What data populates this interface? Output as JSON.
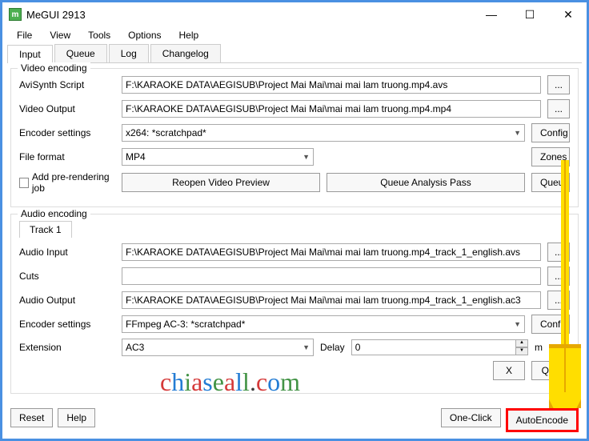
{
  "window": {
    "title": "MeGUI 2913"
  },
  "menubar": {
    "file": "File",
    "view": "View",
    "tools": "Tools",
    "options": "Options",
    "help": "Help"
  },
  "tabs": {
    "input": "Input",
    "queue": "Queue",
    "log": "Log",
    "changelog": "Changelog"
  },
  "video": {
    "legend": "Video encoding",
    "avisynth_label": "AviSynth Script",
    "avisynth_value": "F:\\KARAOKE DATA\\AEGISUB\\Project Mai Mai\\mai mai lam truong.mp4.avs",
    "output_label": "Video Output",
    "output_value": "F:\\KARAOKE DATA\\AEGISUB\\Project Mai Mai\\mai mai lam truong.mp4.mp4",
    "encoder_label": "Encoder settings",
    "encoder_value": "x264: *scratchpad*",
    "format_label": "File format",
    "format_value": "MP4",
    "prerender_label": "Add pre-rendering job",
    "reopen_btn": "Reopen Video Preview",
    "queue_analysis_btn": "Queue Analysis Pass",
    "config_btn": "Config",
    "zones_btn": "Zones",
    "queue_btn": "Queue",
    "browse_btn": "..."
  },
  "audio": {
    "legend": "Audio encoding",
    "track1": "Track 1",
    "input_label": "Audio Input",
    "input_value": "F:\\KARAOKE DATA\\AEGISUB\\Project Mai Mai\\mai mai lam truong.mp4_track_1_english.avs",
    "cuts_label": "Cuts",
    "cuts_value": "",
    "output_label": "Audio Output",
    "output_value": "F:\\KARAOKE DATA\\AEGISUB\\Project Mai Mai\\mai mai lam truong.mp4_track_1_english.ac3",
    "encoder_label": "Encoder settings",
    "encoder_value": "FFmpeg AC-3: *scratchpad*",
    "extension_label": "Extension",
    "extension_value": "AC3",
    "delay_label": " Delay",
    "delay_value": "0",
    "ms_label": "m",
    "x_btn": "X",
    "queue_btn": "Que",
    "config_btn": "Config",
    "browse_btn": "..."
  },
  "bottom": {
    "reset": "Reset",
    "help": "Help",
    "oneclick": "One-Click",
    "autoencode": "AutoEncode"
  },
  "watermark": {
    "text": "chiaseall.com"
  }
}
